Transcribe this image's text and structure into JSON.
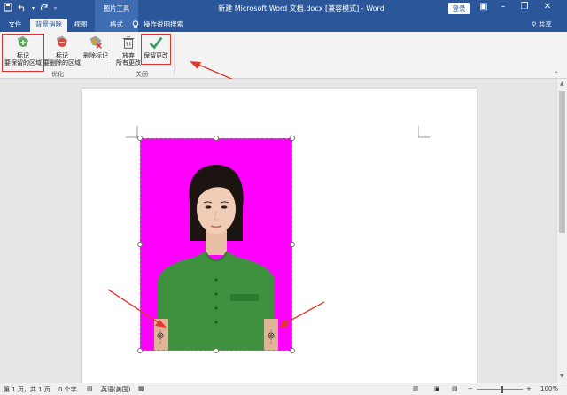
{
  "titlebar": {
    "context_tool": "图片工具",
    "doc_title": "新建 Microsoft Word 文档.docx [兼容模式] - Word",
    "login": "登录"
  },
  "tabs": {
    "file": "文件",
    "bg_remove": "背景消除",
    "view": "视图",
    "format": "格式",
    "search": "操作说明搜索",
    "share": "共享"
  },
  "ribbon": {
    "mark_keep_line1": "标记",
    "mark_keep_line2": "要保留的区域",
    "mark_remove_line1": "标记",
    "mark_remove_line2": "要删除的区域",
    "delete_mark": "删除标记",
    "discard_line1": "放弃",
    "discard_line2": "所有更改",
    "keep_changes": "保留更改",
    "group_optimize": "优化",
    "group_close": "关闭"
  },
  "status": {
    "page": "第 1 页，共 1 页",
    "words": "0 个字",
    "lang": "英语(美国)",
    "zoom": "100%"
  },
  "colors": {
    "brand": "#2b579a",
    "photo_background": "#ff00ff",
    "highlight_box": "#d9342b",
    "arrow": "#e0392f"
  }
}
